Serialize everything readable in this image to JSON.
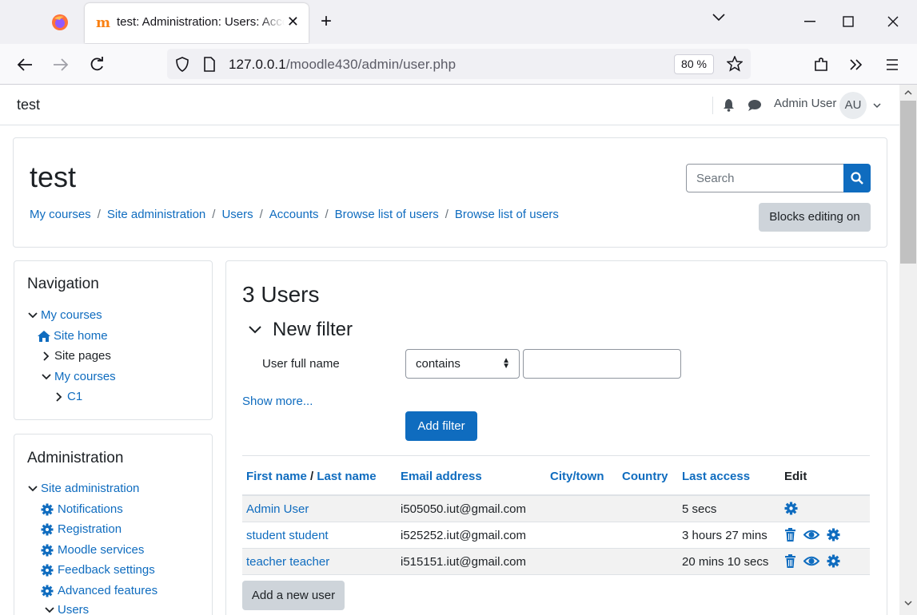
{
  "browser": {
    "tab_title": "test: Administration: Users: Accounts: Browse list of users",
    "url_host": "127.0.0.1",
    "url_path": "/moodle430/admin/user.php",
    "zoom": "80 %"
  },
  "header": {
    "site_name": "test",
    "user_name": "Admin User",
    "avatar_initials": "AU"
  },
  "page": {
    "title": "test",
    "search_placeholder": "Search",
    "blocks_editing": "Blocks editing on",
    "breadcrumbs": [
      "My courses",
      "Site administration",
      "Users",
      "Accounts",
      "Browse list of users",
      "Browse list of users"
    ],
    "breadcrumb_sep": "/"
  },
  "navigation": {
    "title": "Navigation",
    "items": [
      {
        "label": "My courses"
      },
      {
        "label": "Site home"
      },
      {
        "label": "Site pages"
      },
      {
        "label": "My courses"
      },
      {
        "label": "C1"
      }
    ]
  },
  "administration": {
    "title": "Administration",
    "items": [
      {
        "label": "Site administration"
      },
      {
        "label": "Notifications"
      },
      {
        "label": "Registration"
      },
      {
        "label": "Moodle services"
      },
      {
        "label": "Feedback settings"
      },
      {
        "label": "Advanced features"
      },
      {
        "label": "Users"
      }
    ]
  },
  "main": {
    "users_title": "3 Users",
    "filter_title": "New filter",
    "field_label": "User full name",
    "select_value": "contains",
    "show_more": "Show more...",
    "add_filter": "Add filter",
    "add_user": "Add a new user",
    "columns": {
      "first_name": "First name",
      "slash": "/",
      "last_name": "Last name",
      "email": "Email address",
      "city": "City/town",
      "country": "Country",
      "last_access": "Last access",
      "edit": "Edit"
    },
    "rows": [
      {
        "name": "Admin User",
        "email": "i505050.iut@gmail.com",
        "city": "",
        "country": "",
        "last_access": "5 secs"
      },
      {
        "name": "student student",
        "email": "i525252.iut@gmail.com",
        "city": "",
        "country": "",
        "last_access": "3 hours 27 mins"
      },
      {
        "name": "teacher teacher",
        "email": "i515151.iut@gmail.com",
        "city": "",
        "country": "",
        "last_access": "20 mins 10 secs"
      }
    ]
  },
  "colors": {
    "link": "#0f6cbf",
    "primary_button": "#0f6cbf",
    "secondary_button": "#ced4da"
  }
}
